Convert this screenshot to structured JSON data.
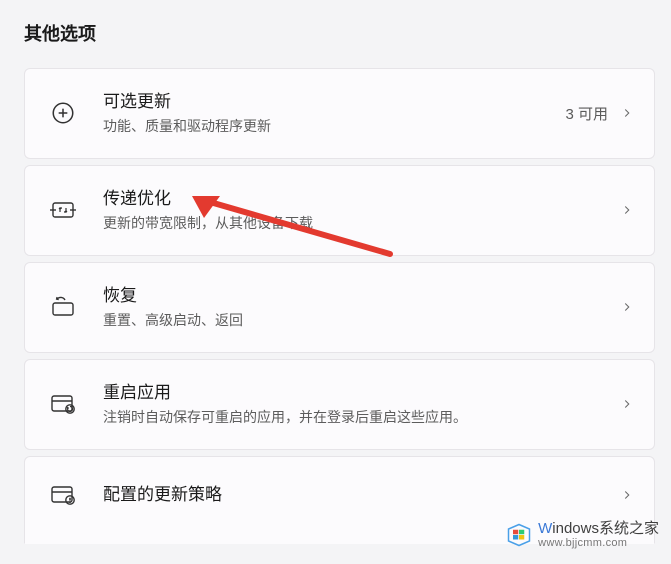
{
  "section_title": "其他选项",
  "items": [
    {
      "icon": "plus-circle",
      "title": "可选更新",
      "subtitle": "功能、质量和驱动程序更新",
      "badge": "3 可用"
    },
    {
      "icon": "delivery-optimization",
      "title": "传递优化",
      "subtitle": "更新的带宽限制，从其他设备下载",
      "badge": ""
    },
    {
      "icon": "recovery",
      "title": "恢复",
      "subtitle": "重置、高级启动、返回",
      "badge": ""
    },
    {
      "icon": "restart-apps",
      "title": "重启应用",
      "subtitle": "注销时自动保存可重启的应用，并在登录后重启这些应用。",
      "badge": ""
    },
    {
      "icon": "update-policy",
      "title": "配置的更新策略",
      "subtitle": "",
      "badge": ""
    }
  ],
  "watermark": {
    "brand_prefix": "W",
    "brand_rest": "indows",
    "brand_suffix": "系统之家",
    "url": "www.bjjcmm.com"
  },
  "annotation": {
    "color": "#e33a2f"
  }
}
